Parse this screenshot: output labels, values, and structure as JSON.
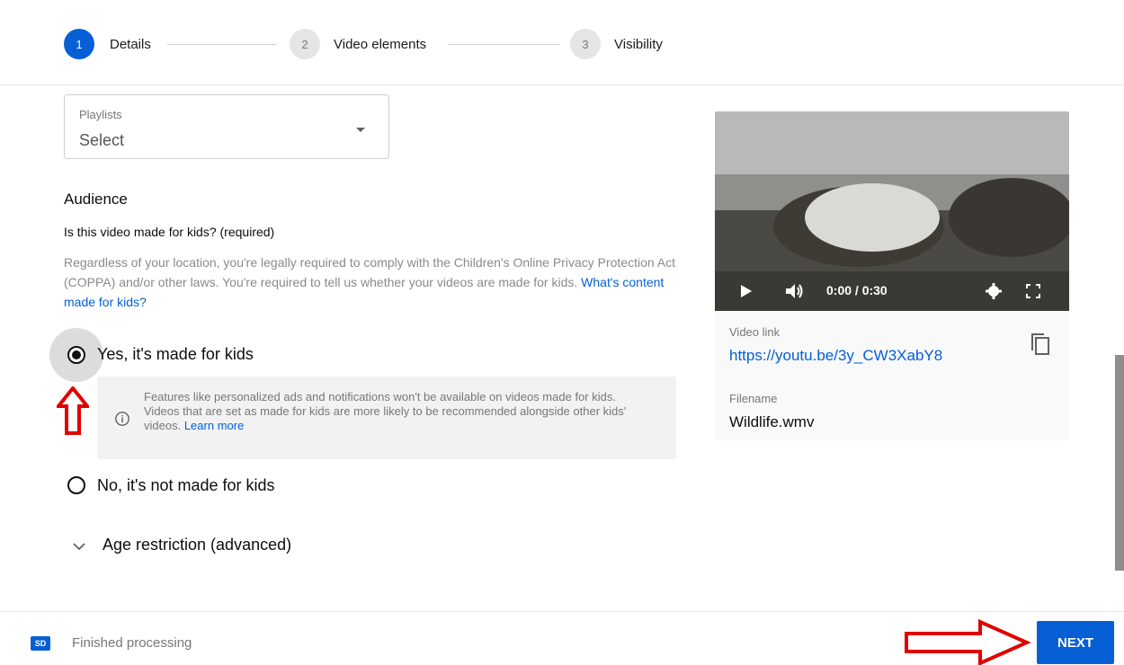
{
  "stepper": {
    "steps": [
      {
        "number": "1",
        "label": "Details"
      },
      {
        "number": "2",
        "label": "Video elements"
      },
      {
        "number": "3",
        "label": "Visibility"
      }
    ]
  },
  "playlists": {
    "label": "Playlists",
    "value": "Select"
  },
  "audience": {
    "title": "Audience",
    "question": "Is this video made for kids? (required)",
    "description": "Regardless of your location, you're legally required to comply with the Children's Online Privacy Protection Act (COPPA) and/or other laws. You're required to tell us whether your videos are made for kids.",
    "link": "What's content made for kids?",
    "option_yes": "Yes, it's made for kids",
    "option_no": "No, it's not made for kids",
    "selected": "yes",
    "info_text": "Features like personalized ads and notifications won't be available on videos made for kids. Videos that are set as made for kids are more likely to be recommended alongside other kids' videos.",
    "info_link": "Learn more",
    "age_restriction": "Age restriction (advanced)"
  },
  "video_card": {
    "time": "0:00 / 0:30",
    "link_label": "Video link",
    "link": "https://youtu.be/3y_CW3XabY8",
    "filename_label": "Filename",
    "filename": "Wildlife.wmv"
  },
  "footer": {
    "badge": "SD",
    "status": "Finished processing",
    "next_label": "NEXT"
  },
  "colors": {
    "accent": "#065fd4",
    "annotation": "#e00000"
  }
}
